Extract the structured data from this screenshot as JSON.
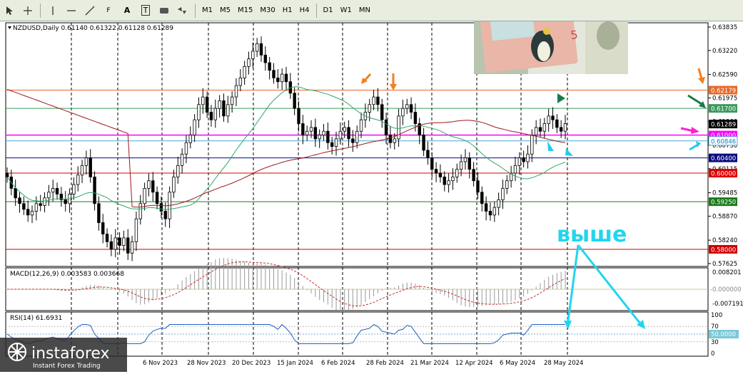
{
  "toolbar": {
    "tools": [
      "cursor-icon",
      "crosshair-icon",
      "vertical-line-icon",
      "horizontal-line-icon",
      "trendline-icon",
      "fibonacci-icon",
      "text-icon",
      "label-icon",
      "rectangle-icon",
      "shapes-icon"
    ],
    "text_tool": "A",
    "label_tool": "T",
    "fib_tool": "F",
    "timeframes": [
      "M1",
      "M5",
      "M15",
      "M30",
      "H1",
      "H4",
      "D1",
      "W1",
      "MN"
    ]
  },
  "chart": {
    "symbol_info": "NZDUSD,Daily  0.61140 0.61322 0.61128 0.61289",
    "price_ticks": [
      "0.63835",
      "0.63220",
      "0.62590",
      "0.61975",
      "0.61360",
      "0.60730",
      "0.60115",
      "0.59485",
      "0.58870",
      "0.58240",
      "0.57625"
    ],
    "level_labels": [
      {
        "text": "0.62179",
        "bg": "#e8692b",
        "fg": "#ffffff"
      },
      {
        "text": "0.61700",
        "bg": "#3a9a5a",
        "fg": "#ffffff"
      },
      {
        "text": "0.61289",
        "bg": "#000000",
        "fg": "#ffffff"
      },
      {
        "text": "0.61000",
        "bg": "#ff00ff",
        "fg": "#ffffff"
      },
      {
        "text": "0.60846",
        "bg": "#ffffff",
        "fg": "#0080c0"
      },
      {
        "text": "0.60400",
        "bg": "#0a0a80",
        "fg": "#ffffff"
      },
      {
        "text": "0.60000",
        "bg": "#dd0000",
        "fg": "#ffffff"
      },
      {
        "text": "0.59250",
        "bg": "#1a7a1a",
        "fg": "#ffffff"
      },
      {
        "text": "0.58000",
        "bg": "#cc0000",
        "fg": "#ffffff"
      }
    ],
    "annotation": "выше",
    "date_ticks": [
      "6 Nov 2023",
      "28 Nov 2023",
      "20 Dec 2023",
      "15 Jan 2024",
      "6 Feb 2024",
      "28 Feb 2024",
      "21 Mar 2024",
      "12 Apr 2024",
      "6 May 2024",
      "28 May 2024"
    ]
  },
  "macd": {
    "label": "MACD(12,26,9) 0.003583 0.003668",
    "ticks": [
      "0.008201",
      "-0.000000",
      "-0.007191"
    ]
  },
  "rsi": {
    "label": "RSI(14) 61.6931",
    "ticks": [
      "100",
      "70",
      "50.0000",
      "30",
      "0"
    ]
  },
  "watermark": {
    "brand": "instaforex",
    "tagline": "Instant Forex Trading"
  },
  "chart_data": {
    "type": "candlestick",
    "symbol": "NZDUSD",
    "timeframe": "Daily",
    "ohlc_current": {
      "open": 0.6114,
      "high": 0.61322,
      "low": 0.61128,
      "close": 0.61289
    },
    "ylim": [
      0.57625,
      0.63835
    ],
    "horizontal_levels": [
      0.62179,
      0.617,
      0.61,
      0.60846,
      0.604,
      0.6,
      0.5925,
      0.58
    ],
    "close_series": [
      0.599,
      0.596,
      0.5935,
      0.592,
      0.5905,
      0.589,
      0.59,
      0.592,
      0.5915,
      0.5935,
      0.595,
      0.596,
      0.5945,
      0.593,
      0.592,
      0.5945,
      0.597,
      0.5995,
      0.602,
      0.604,
      0.599,
      0.592,
      0.587,
      0.584,
      0.582,
      0.58,
      0.583,
      0.581,
      0.583,
      0.579,
      0.582,
      0.588,
      0.592,
      0.596,
      0.598,
      0.595,
      0.592,
      0.59,
      0.588,
      0.595,
      0.599,
      0.602,
      0.605,
      0.608,
      0.61,
      0.614,
      0.618,
      0.62,
      0.616,
      0.614,
      0.617,
      0.619,
      0.615,
      0.618,
      0.62,
      0.623,
      0.625,
      0.628,
      0.63,
      0.632,
      0.634,
      0.631,
      0.629,
      0.627,
      0.625,
      0.624,
      0.626,
      0.624,
      0.621,
      0.617,
      0.613,
      0.61,
      0.611,
      0.612,
      0.609,
      0.61,
      0.611,
      0.608,
      0.607,
      0.609,
      0.611,
      0.612,
      0.609,
      0.608,
      0.611,
      0.614,
      0.616,
      0.618,
      0.62,
      0.618,
      0.614,
      0.61,
      0.608,
      0.609,
      0.615,
      0.617,
      0.618,
      0.616,
      0.613,
      0.61,
      0.606,
      0.604,
      0.601,
      0.6,
      0.599,
      0.597,
      0.598,
      0.599,
      0.601,
      0.603,
      0.604,
      0.601,
      0.598,
      0.595,
      0.592,
      0.59,
      0.589,
      0.591,
      0.593,
      0.596,
      0.598,
      0.6,
      0.602,
      0.604,
      0.603,
      0.605,
      0.61,
      0.612,
      0.611,
      0.613,
      0.615,
      0.614,
      0.612,
      0.611,
      0.613
    ]
  }
}
